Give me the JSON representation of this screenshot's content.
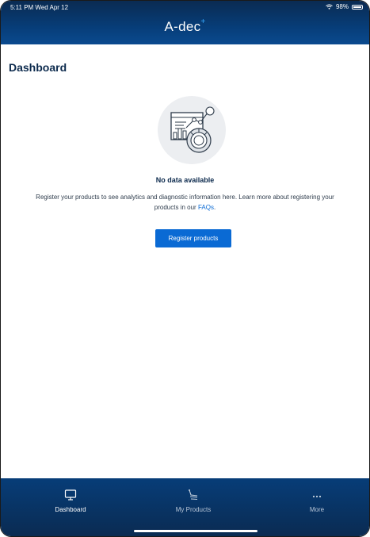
{
  "status_bar": {
    "time": "5:11 PM  Wed Apr 12",
    "battery_text": "98%",
    "battery_level": 0.98,
    "wifi_icon": "wifi-icon"
  },
  "header": {
    "brand": "A-dec",
    "brand_mark": "+"
  },
  "page": {
    "title": "Dashboard"
  },
  "empty_state": {
    "illustration_icon": "analytics-illustration-icon",
    "title": "No data available",
    "message": "Register your products to see analytics and diagnostic information here. Learn more about registering your products in our ",
    "faq_link": "FAQs",
    "message_end": ".",
    "button_label": "Register products"
  },
  "tabbar": {
    "tabs": [
      {
        "label": "Dashboard",
        "icon": "monitor-icon",
        "active": true
      },
      {
        "label": "My Products",
        "icon": "dental-chair-icon",
        "active": false
      },
      {
        "label": "More",
        "icon": "more-dots-icon",
        "active": false
      }
    ]
  },
  "colors": {
    "header_bg": "#073d78",
    "accent": "#0a6ad4",
    "title_text": "#0c2a4d",
    "brand_plus": "#36a9ff"
  }
}
